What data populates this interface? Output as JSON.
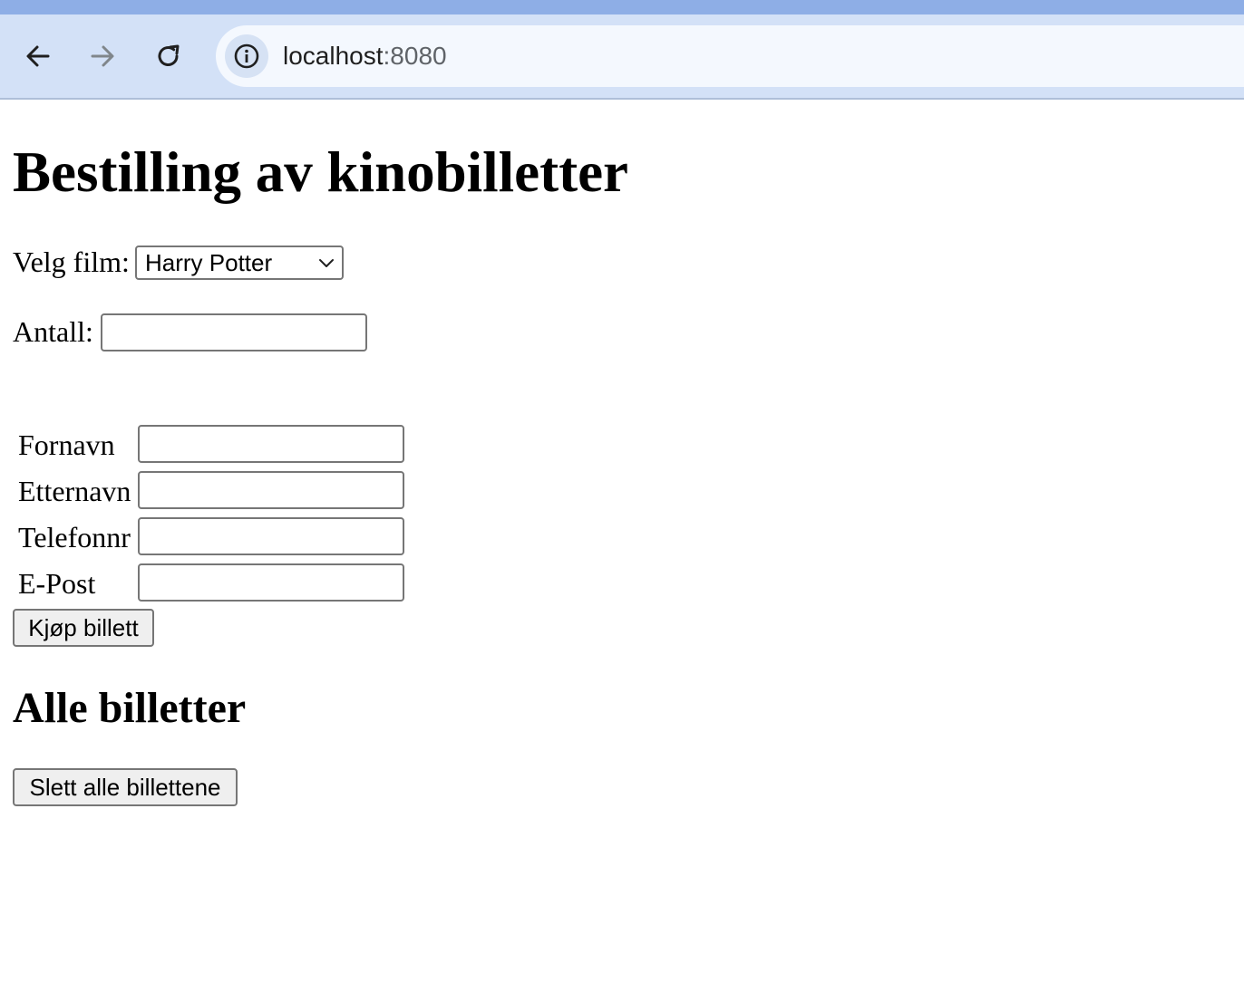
{
  "browser": {
    "url_host": "localhost",
    "url_port": ":8080",
    "icons": [
      "back-arrow-icon",
      "forward-arrow-icon",
      "reload-icon",
      "site-info-icon"
    ]
  },
  "page": {
    "title": "Bestilling av kinobilletter",
    "film_label": "Velg film:",
    "film_selected": "Harry Potter",
    "count_label": "Antall:",
    "count_value": "",
    "fields": [
      {
        "label": "Fornavn",
        "value": ""
      },
      {
        "label": "Etternavn",
        "value": ""
      },
      {
        "label": "Telefonnr",
        "value": ""
      },
      {
        "label": "E-Post",
        "value": ""
      }
    ],
    "buy_button": "Kjøp billett",
    "tickets_heading": "Alle billetter",
    "delete_button": "Slett alle billettene"
  }
}
